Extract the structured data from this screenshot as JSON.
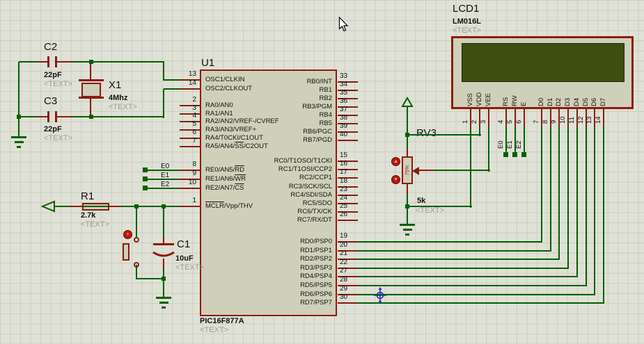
{
  "app": {
    "wire_color": "#006000",
    "pin_color": "#8b1a10",
    "fill_color": "#cfd0b9",
    "screen_color": "#3d4e10",
    "muted_color": "#9c9d95"
  },
  "pic": {
    "ref": "U1",
    "part": "PIC16F877A",
    "note": "<TEXT>",
    "left_groups": [
      {
        "pins": [
          {
            "num": "13",
            "name": "OSC1/CLKIN"
          },
          {
            "num": "14",
            "name": "OSC2/CLKOUT"
          }
        ]
      },
      {
        "pins": [
          {
            "num": "2",
            "name": "RA0/AN0"
          },
          {
            "num": "3",
            "name": "RA1/AN1"
          },
          {
            "num": "4",
            "name": "RA2/AN2/VREF-/CVREF"
          },
          {
            "num": "5",
            "name": "RA3/AN3/VREF+"
          },
          {
            "num": "6",
            "name": "RA4/T0CKI/C1OUT"
          },
          {
            "num": "7",
            "name": "RA5/AN4/[SS]/C2OUT"
          }
        ]
      },
      {
        "pins": [
          {
            "num": "8",
            "name": "RE0/AN5/[RD]"
          },
          {
            "num": "9",
            "name": "RE1/AN6/[WR]"
          },
          {
            "num": "10",
            "name": "RE2/AN7/[CS]"
          }
        ]
      },
      {
        "pins": [
          {
            "num": "1",
            "name": "[MCLR]/Vpp/THV"
          }
        ]
      }
    ],
    "right_groups": [
      {
        "pins": [
          {
            "num": "33",
            "name": "RB0/INT"
          },
          {
            "num": "34",
            "name": "RB1"
          },
          {
            "num": "35",
            "name": "RB2"
          },
          {
            "num": "36",
            "name": "RB3/PGM"
          },
          {
            "num": "37",
            "name": "RB4"
          },
          {
            "num": "38",
            "name": "RB5"
          },
          {
            "num": "39",
            "name": "RB6/PGC"
          },
          {
            "num": "40",
            "name": "RB7/PGD"
          }
        ]
      },
      {
        "pins": [
          {
            "num": "15",
            "name": "RC0/T1OSO/T1CKI"
          },
          {
            "num": "16",
            "name": "RC1/T1OSI/CCP2"
          },
          {
            "num": "17",
            "name": "RC2/CCP1"
          },
          {
            "num": "18",
            "name": "RC3/SCK/SCL"
          },
          {
            "num": "23",
            "name": "RC4/SDI/SDA"
          },
          {
            "num": "24",
            "name": "RC5/SDO"
          },
          {
            "num": "25",
            "name": "RC6/TX/CK"
          },
          {
            "num": "26",
            "name": "RC7/RX/DT"
          }
        ]
      },
      {
        "pins": [
          {
            "num": "19",
            "name": "RD0/PSP0"
          },
          {
            "num": "20",
            "name": "RD1/PSP1"
          },
          {
            "num": "21",
            "name": "RD2/PSP2"
          },
          {
            "num": "22",
            "name": "RD3/PSP3"
          },
          {
            "num": "27",
            "name": "RD4/PSP4"
          },
          {
            "num": "28",
            "name": "RD5/PSP5"
          },
          {
            "num": "29",
            "name": "RD6/PSP6"
          },
          {
            "num": "30",
            "name": "RD7/PSP7"
          }
        ]
      }
    ]
  },
  "lcd": {
    "ref": "LCD1",
    "part": "LM016L",
    "note": "<TEXT>",
    "pin_groups": [
      {
        "pins": [
          {
            "num": "1",
            "name": "VSS"
          },
          {
            "num": "2",
            "name": "VDD"
          },
          {
            "num": "3",
            "name": "VEE"
          }
        ]
      },
      {
        "pins": [
          {
            "num": "4",
            "name": "RS"
          },
          {
            "num": "5",
            "name": "RW"
          },
          {
            "num": "6",
            "name": "E"
          }
        ]
      },
      {
        "pins": [
          {
            "num": "7",
            "name": "D0"
          },
          {
            "num": "8",
            "name": "D1"
          },
          {
            "num": "9",
            "name": "D2"
          },
          {
            "num": "10",
            "name": "D3"
          },
          {
            "num": "11",
            "name": "D4"
          },
          {
            "num": "12",
            "name": "D5"
          },
          {
            "num": "13",
            "name": "D6"
          },
          {
            "num": "14",
            "name": "D7"
          }
        ]
      }
    ]
  },
  "components": {
    "c2": {
      "ref": "C2",
      "value": "22pF",
      "note": "<TEXT>"
    },
    "c3": {
      "ref": "C3",
      "value": "22pF",
      "note": "<TEXT>"
    },
    "x1": {
      "ref": "X1",
      "value": "4Mhz",
      "note": "<TEXT>"
    },
    "r1": {
      "ref": "R1",
      "value": "2.7k",
      "note": "<TEXT>"
    },
    "c1": {
      "ref": "C1",
      "value": "10uF",
      "note": "<TEXT>"
    },
    "rv3": {
      "ref": "RV3",
      "value": "5k",
      "note": "<TEXT>",
      "wiper": "75%"
    }
  },
  "nets": {
    "pic_side": [
      "E0",
      "E1",
      "E2"
    ],
    "lcd_side": [
      "E0",
      "E1",
      "E2"
    ]
  },
  "icons": {
    "up": "▲",
    "down": "▼",
    "button": "+"
  }
}
